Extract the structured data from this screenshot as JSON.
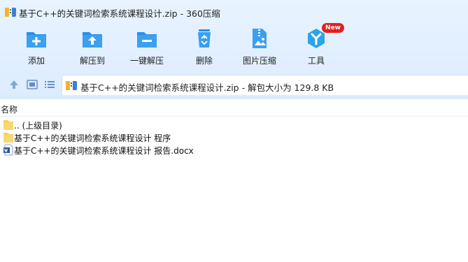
{
  "window": {
    "title": "基于C++的关键词检索系统课程设计.zip - 360压缩",
    "app_icon": "archive-icon"
  },
  "toolbar": {
    "items": [
      {
        "label": "添加",
        "icon": "add-folder-icon"
      },
      {
        "label": "解压到",
        "icon": "extract-to-folder-icon"
      },
      {
        "label": "一键解压",
        "icon": "one-click-extract-icon"
      },
      {
        "label": "删除",
        "icon": "recycle-bin-icon"
      },
      {
        "label": "图片压缩",
        "icon": "image-compress-icon"
      },
      {
        "label": "工具",
        "icon": "tools-icon",
        "badge": "New"
      }
    ]
  },
  "address": {
    "text": "基于C++的关键词检索系统课程设计.zip - 解包大小为 129.8 KB"
  },
  "filelist": {
    "column_name": "名称",
    "rows": [
      {
        "name": ".. (上级目录)",
        "type": "parent-folder",
        "icon": "folder-icon"
      },
      {
        "name": "基于C++的关键词检索系统课程设计 程序",
        "type": "folder",
        "icon": "folder-icon"
      },
      {
        "name": "基于C++的关键词检索系统课程设计 报告.docx",
        "type": "docx",
        "icon": "word-document-icon"
      }
    ]
  },
  "colors": {
    "accent_blue": "#2b8ee6",
    "toolbar_bg": "#e4f0fd",
    "folder_yellow": "#f7cf5a",
    "badge_red": "#e02020"
  }
}
